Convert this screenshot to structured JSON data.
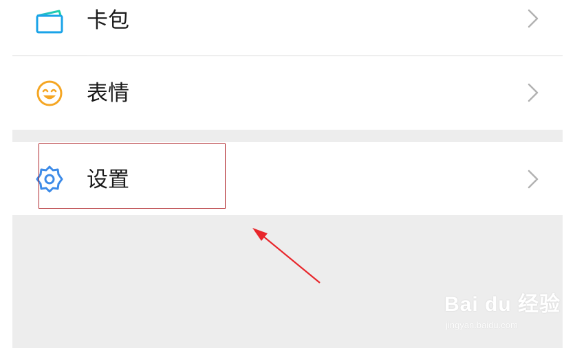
{
  "menu": {
    "items": [
      {
        "label": "卡包",
        "icon": "wallet-card-icon",
        "icon_color": "#1aa3e8"
      },
      {
        "label": "表情",
        "icon": "smiley-face-icon",
        "icon_color": "#f5a623"
      },
      {
        "label": "设置",
        "icon": "gear-icon",
        "icon_color": "#3d8be8"
      }
    ],
    "chevron_icon": "chevron-right-icon"
  },
  "annotation": {
    "highlight_color": "#b0272c",
    "arrow_color": "#e8262b"
  },
  "watermark": {
    "brand": "Bai du 经验",
    "url": "jingyan.baidu.com"
  }
}
